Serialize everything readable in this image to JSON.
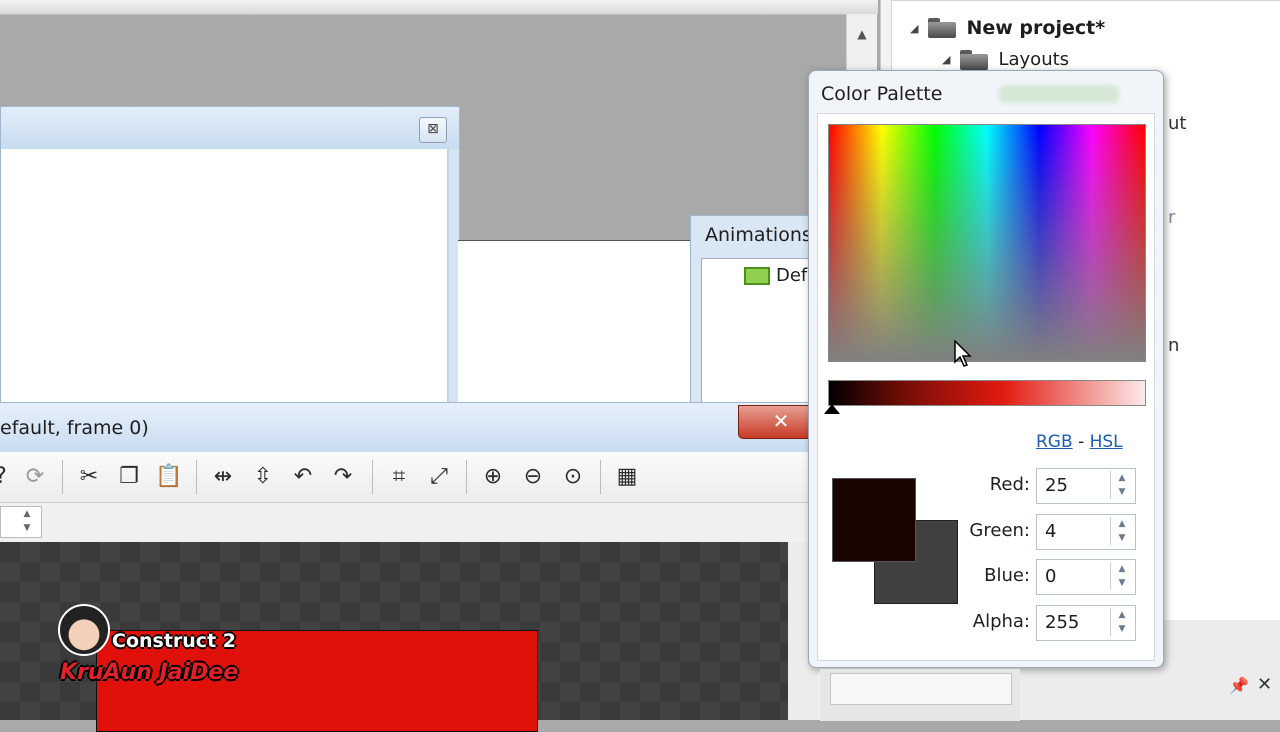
{
  "project": {
    "root": "New project*",
    "layouts": "Layouts",
    "clipped": [
      "ut",
      "r",
      "n"
    ]
  },
  "animations": {
    "title": "Animations",
    "item": "Def"
  },
  "editor": {
    "title": "efault, frame 0)",
    "close": "✕"
  },
  "toolbar": {
    "icons": [
      "help-icon",
      "refresh-icon",
      "cut-icon",
      "copy-icon",
      "paste-icon",
      "flip-horizontal-icon",
      "flip-vertical-icon",
      "rotate-ccw-icon",
      "rotate-cw-icon",
      "crop-icon",
      "resize-icon",
      "zoom-in-icon",
      "zoom-out-icon",
      "zoom-reset-icon",
      "transparency-icon"
    ]
  },
  "palette": {
    "title": "Color Palette",
    "mode_rgb": "RGB",
    "mode_sep": "-",
    "mode_hsl": "HSL",
    "fields": [
      {
        "label": "Red:",
        "value": "25"
      },
      {
        "label": "Green:",
        "value": "4"
      },
      {
        "label": "Blue:",
        "value": "0"
      },
      {
        "label": "Alpha:",
        "value": "255"
      }
    ],
    "current_color": "#190400",
    "previous_color": "#404040"
  },
  "watermark": {
    "line1": "Construct 2",
    "line2": "KruAun JaiDee"
  }
}
